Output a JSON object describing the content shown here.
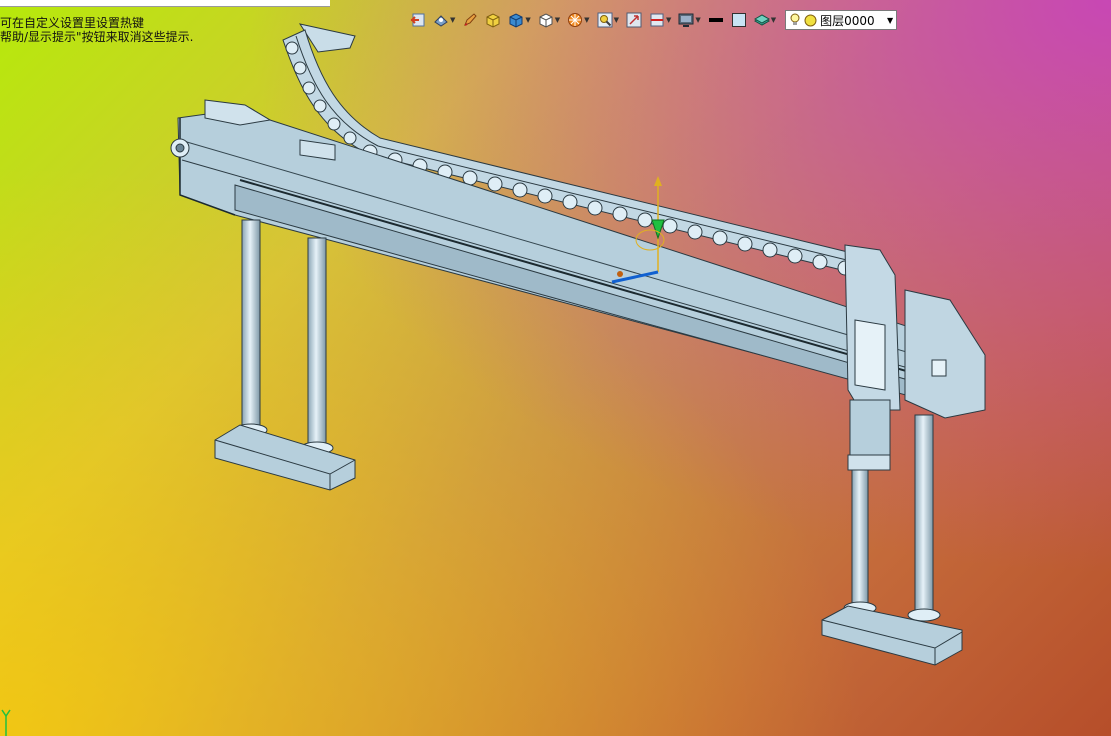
{
  "hints": {
    "line1": "可在自定义设置里设置热键",
    "line2": "帮助/显示提示\"按钮来取消这些提示."
  },
  "toolbar": {
    "items": [
      {
        "name": "view-return-icon",
        "has_dropdown": false
      },
      {
        "name": "view-orient-icon",
        "has_dropdown": true
      },
      {
        "name": "pencil-icon",
        "has_dropdown": false
      },
      {
        "name": "shaded-box-icon",
        "has_dropdown": false
      },
      {
        "name": "solid-cube-icon",
        "has_dropdown": true
      },
      {
        "name": "wire-cube-icon",
        "has_dropdown": true
      },
      {
        "name": "section-wheel-icon",
        "has_dropdown": true
      },
      {
        "name": "zoom-fit-icon",
        "has_dropdown": true
      },
      {
        "name": "fit-window-icon",
        "has_dropdown": false
      },
      {
        "name": "clip-plane-icon",
        "has_dropdown": true
      },
      {
        "name": "monitor-icon",
        "has_dropdown": true
      },
      {
        "name": "line-color-icon",
        "has_dropdown": false
      },
      {
        "name": "fill-color-icon",
        "has_dropdown": false
      },
      {
        "name": "layer-stack-icon",
        "has_dropdown": true
      }
    ],
    "layer_select": {
      "value": "图层0000"
    }
  },
  "colors": {
    "part": "#b6cfdc",
    "part_edge": "#2b3a42",
    "axis_y": "#e0b020",
    "axis_z": "#1060d0"
  },
  "triad": {
    "y_label": "Y"
  }
}
